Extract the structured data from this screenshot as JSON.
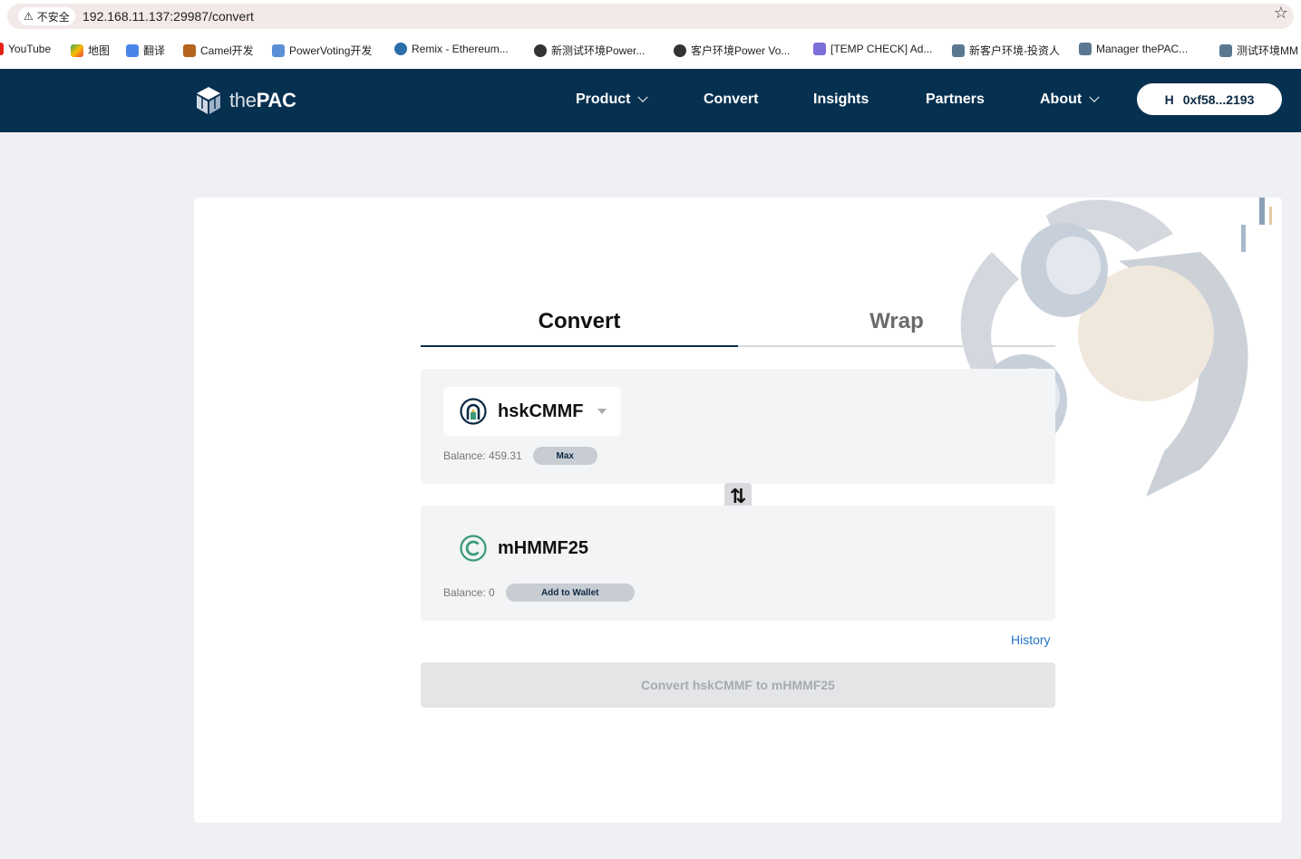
{
  "browser": {
    "security_label": "不安全",
    "url": "192.168.11.137:29987/convert",
    "bookmarks": [
      {
        "label": "YouTube",
        "icon": "youtube-icon"
      },
      {
        "label": "地图",
        "icon": "maps-icon"
      },
      {
        "label": "翻译",
        "icon": "translate-icon"
      },
      {
        "label": "Camel开发",
        "icon": "camel-icon"
      },
      {
        "label": "PowerVoting开发",
        "icon": "powervoting-icon"
      },
      {
        "label": "Remix - Ethereum...",
        "icon": "remix-icon"
      },
      {
        "label": "新测试环境Power...",
        "icon": "globe-icon"
      },
      {
        "label": "客户环境Power Vo...",
        "icon": "globe-icon"
      },
      {
        "label": "[TEMP CHECK] Ad...",
        "icon": "discord-icon"
      },
      {
        "label": "新客户环境-投资人",
        "icon": "thepac-icon"
      },
      {
        "label": "Manager thePAC...",
        "icon": "thepac-icon"
      },
      {
        "label": "测试环境MM",
        "icon": "thepac-icon"
      }
    ]
  },
  "nav": {
    "brand_the": "the",
    "brand_pac": "PAC",
    "items": [
      {
        "label": "Product",
        "dropdown": true
      },
      {
        "label": "Convert",
        "dropdown": false
      },
      {
        "label": "Insights",
        "dropdown": false
      },
      {
        "label": "Partners",
        "dropdown": false
      },
      {
        "label": "About",
        "dropdown": true
      }
    ],
    "wallet": "0xf58...2193"
  },
  "tabs": [
    {
      "label": "Convert",
      "active": true
    },
    {
      "label": "Wrap",
      "active": false
    }
  ],
  "from": {
    "token": "hskCMMF",
    "balance": "Balance: 459.31",
    "action": "Max"
  },
  "to": {
    "token": "mHMMF25",
    "balance": "Balance: 0",
    "action": "Add to Wallet"
  },
  "swap_icon": "⇅",
  "history": "History",
  "convert_button": "Convert hskCMMF to mHMMF25",
  "colors": {
    "navbar": "#063050",
    "accent_link": "#2474c7",
    "hsk_icon": "#0d2a45",
    "m_icon": "#3a9a7a"
  }
}
